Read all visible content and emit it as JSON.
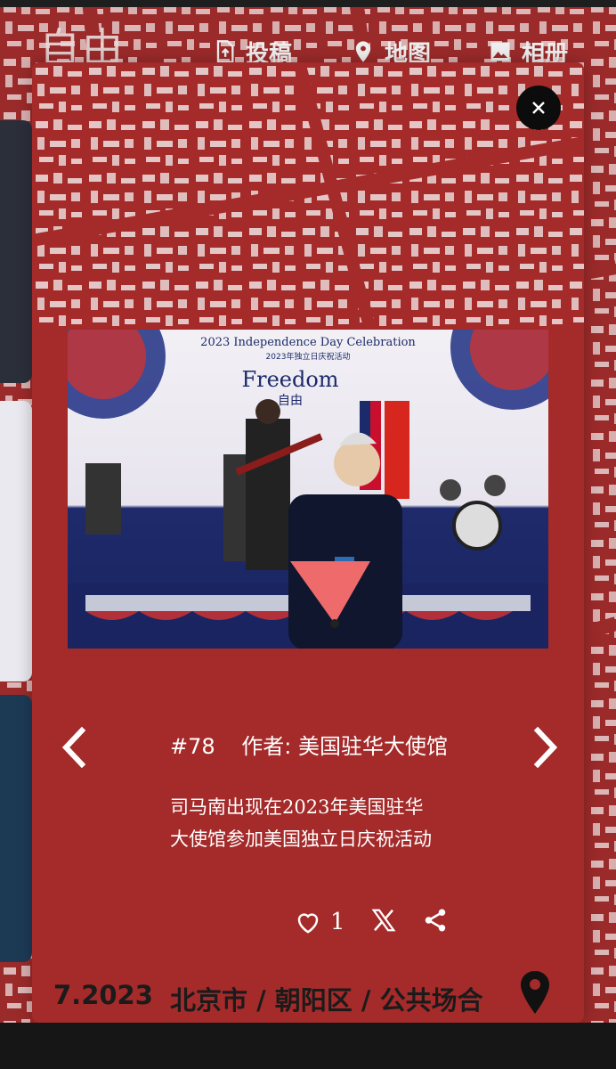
{
  "app": {
    "logo_text": "自由",
    "nav": [
      {
        "label": "投稿",
        "icon": "upload-file-icon"
      },
      {
        "label": "地图",
        "icon": "map-pin-icon"
      },
      {
        "label": "相册",
        "icon": "photo-album-icon"
      }
    ]
  },
  "modal": {
    "close_icon": "close-icon",
    "photo": {
      "banner_line1": "2023 Independence Day Celebration",
      "banner_line2": "2023年独立日庆祝活动",
      "banner_title": "Freedom",
      "banner_title_cn": "自由"
    },
    "post": {
      "number": "#78",
      "author": "作者: 美国驻华大使馆",
      "description": "司马南出现在2023年美国驻华大使馆参加美国独立日庆祝活动",
      "like_count": "1"
    },
    "footer": {
      "date": "7.2023",
      "location": "北京市 / 朝阳区 / 公共场合"
    }
  },
  "colors": {
    "background": "#9b2a2a",
    "modal": "#a52a2a",
    "text_light": "#ffffff",
    "text_dark": "#1b1b1b"
  }
}
